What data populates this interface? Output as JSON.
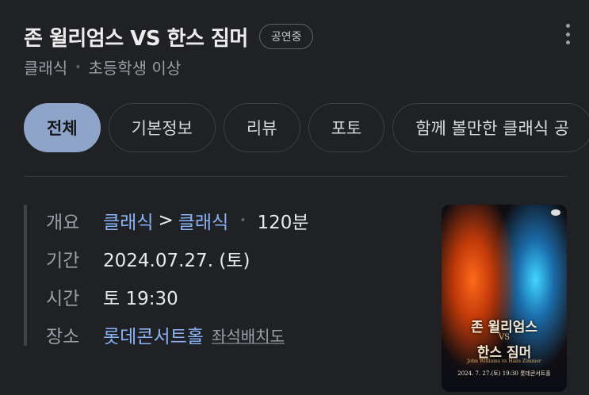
{
  "header": {
    "title": "존 윌리엄스 VS 한스 짐머",
    "status": "공연중",
    "category": "클래식",
    "age": "초등학생 이상"
  },
  "tabs": [
    {
      "label": "전체",
      "active": true
    },
    {
      "label": "기본정보",
      "active": false
    },
    {
      "label": "리뷰",
      "active": false
    },
    {
      "label": "포토",
      "active": false
    },
    {
      "label": "함께 볼만한 클래식 공",
      "active": false
    }
  ],
  "info": {
    "overview_label": "개요",
    "genre_main": "클래식",
    "genre_sub": "클래식",
    "duration": "120분",
    "period_label": "기간",
    "period_value": "2024.07.27. (토)",
    "time_label": "시간",
    "time_value": "토 19:30",
    "place_label": "장소",
    "place_value": "롯데콘서트홀",
    "seat_link": "좌석배치도"
  },
  "poster": {
    "title_line1": "존 윌리엄스",
    "vs": "VS",
    "title_line2": "한스 짐머",
    "names": "John Williams  vs  Hans Zimmer",
    "date": "2024. 7. 27.(토) 19:30 롯데콘서트홀"
  },
  "colors": {
    "accent": "#8ab4f8",
    "active_tab": "#8fa4c9",
    "background": "#202124"
  }
}
